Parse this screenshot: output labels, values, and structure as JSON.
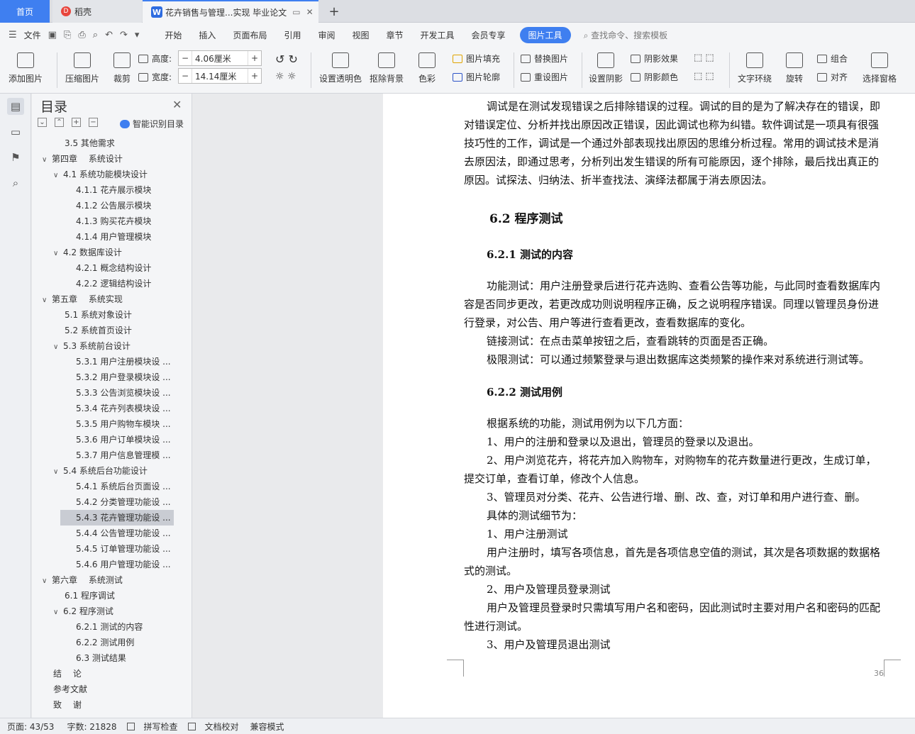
{
  "tabs": {
    "home": "首页",
    "doc1": "稻壳",
    "doc2": "花卉销售与管理...实现 毕业论文"
  },
  "menu": {
    "file": "文件",
    "items": [
      "开始",
      "插入",
      "页面布局",
      "引用",
      "审阅",
      "视图",
      "章节",
      "开发工具",
      "会员专享"
    ],
    "active": "图片工具",
    "search": "查找命令、搜索模板"
  },
  "ribbon": {
    "add_image": "添加图片",
    "compress": "压缩图片",
    "crop": "裁剪",
    "height_label": "高度:",
    "height_value": "4.06厘米",
    "width_label": "宽度:",
    "width_value": "14.14厘米",
    "transparent": "设置透明色",
    "remove_bg": "抠除背景",
    "color": "色彩",
    "fill": "图片填充",
    "outline": "图片轮廓",
    "replace": "替换图片",
    "reset": "重设图片",
    "shadow": "设置阴影",
    "shadow_effect": "阴影效果",
    "shadow_color": "阴影颜色",
    "wrap": "文字环绕",
    "rotate": "旋转",
    "group": "组合",
    "align": "对齐",
    "select_pane": "选择窗格"
  },
  "toc": {
    "title": "目录",
    "smart": "智能识别目录",
    "items": [
      {
        "label": "3.5 其他需求",
        "level": 2,
        "arrow": ""
      },
      {
        "label": "第四章　 系统设计",
        "level": 1,
        "arrow": "v"
      },
      {
        "label": "4.1 系统功能模块设计",
        "level": 2,
        "arrow": "v"
      },
      {
        "label": "4.1.1 花卉展示模块",
        "level": 3,
        "arrow": ""
      },
      {
        "label": "4.1.2 公告展示模块",
        "level": 3,
        "arrow": ""
      },
      {
        "label": "4.1.3 购买花卉模块",
        "level": 3,
        "arrow": ""
      },
      {
        "label": "4.1.4 用户管理模块",
        "level": 3,
        "arrow": ""
      },
      {
        "label": "4.2 数据库设计",
        "level": 2,
        "arrow": "v"
      },
      {
        "label": "4.2.1 概念结构设计",
        "level": 3,
        "arrow": ""
      },
      {
        "label": "4.2.2 逻辑结构设计",
        "level": 3,
        "arrow": ""
      },
      {
        "label": "第五章　 系统实现",
        "level": 1,
        "arrow": "v"
      },
      {
        "label": "5.1 系统对象设计",
        "level": 2,
        "arrow": ""
      },
      {
        "label": "5.2 系统首页设计",
        "level": 2,
        "arrow": ""
      },
      {
        "label": "5.3 系统前台设计",
        "level": 2,
        "arrow": "v"
      },
      {
        "label": "5.3.1 用户注册模块设 ...",
        "level": 3,
        "arrow": ""
      },
      {
        "label": "5.3.2 用户登录模块设 ...",
        "level": 3,
        "arrow": ""
      },
      {
        "label": "5.3.3 公告浏览模块设 ...",
        "level": 3,
        "arrow": ""
      },
      {
        "label": "5.3.4 花卉列表模块设 ...",
        "level": 3,
        "arrow": ""
      },
      {
        "label": "5.3.5 用户购物车模块 ...",
        "level": 3,
        "arrow": ""
      },
      {
        "label": "5.3.6 用户订单模块设 ...",
        "level": 3,
        "arrow": ""
      },
      {
        "label": "5.3.7 用户信息管理模 ...",
        "level": 3,
        "arrow": ""
      },
      {
        "label": "5.4 系统后台功能设计",
        "level": 2,
        "arrow": "v"
      },
      {
        "label": "5.4.1 系统后台页面设 ...",
        "level": 3,
        "arrow": ""
      },
      {
        "label": "5.4.2 分类管理功能设 ...",
        "level": 3,
        "arrow": ""
      },
      {
        "label": "5.4.3 花卉管理功能设 ...",
        "level": 3,
        "arrow": "",
        "selected": true
      },
      {
        "label": "5.4.4 公告管理功能设 ...",
        "level": 3,
        "arrow": ""
      },
      {
        "label": "5.4.5 订单管理功能设 ...",
        "level": 3,
        "arrow": ""
      },
      {
        "label": "5.4.6 用户管理功能设 ...",
        "level": 3,
        "arrow": ""
      },
      {
        "label": "第六章　 系统测试",
        "level": 1,
        "arrow": "v"
      },
      {
        "label": "6.1 程序调试",
        "level": 2,
        "arrow": ""
      },
      {
        "label": "6.2 程序测试",
        "level": 2,
        "arrow": "v"
      },
      {
        "label": "6.2.1 测试的内容",
        "level": 3,
        "arrow": ""
      },
      {
        "label": "6.2.2 测试用例",
        "level": 3,
        "arrow": ""
      },
      {
        "label": "6.3 测试结果",
        "level": 3,
        "arrow": ""
      },
      {
        "label": "结　 论",
        "level": 1,
        "arrow": ""
      },
      {
        "label": "参考文献",
        "level": 1,
        "arrow": ""
      },
      {
        "label": "致　 谢",
        "level": 1,
        "arrow": ""
      }
    ]
  },
  "doc": {
    "p1": "调试是在测试发现错误之后排除错误的过程。调试的目的是为了解决存在的错误，即对错误定位、分析并找出原因改正错误，因此调试也称为纠错。软件调试是一项具有很强技巧性的工作，调试是一个通过外部表现找出原因的思维分析过程。常用的调试技术是消去原因法，即通过思考，分析列出发生错误的所有可能原因，逐个排除，最后找出真正的原因。试探法、归纳法、折半查找法、演绎法都属于消去原因法。",
    "h62": "6.2 程序测试",
    "h621": "6.2.1 测试的内容",
    "p2": "功能测试：用户注册登录后进行花卉选购、查看公告等功能，与此同时查看数据库内容是否同步更改，若更改成功则说明程序正确，反之说明程序错误。同理以管理员身份进行登录，对公告、用户等进行查看更改，查看数据库的变化。",
    "p3": "链接测试：在点击菜单按钮之后，查看跳转的页面是否正确。",
    "p4": "极限测试：可以通过频繁登录与退出数据库这类频繁的操作来对系统进行测试等。",
    "h622": "6.2.2 测试用例",
    "p5": "根据系统的功能，测试用例为以下几方面：",
    "p6": "1、用户的注册和登录以及退出，管理员的登录以及退出。",
    "p7": "2、用户浏览花卉，将花卉加入购物车，对购物车的花卉数量进行更改，生成订单，提交订单，查看订单，修改个人信息。",
    "p8": "3、管理员对分类、花卉、公告进行增、删、改、查，对订单和用户进行查、删。",
    "p9": "具体的测试细节为：",
    "p10": "1、用户注册测试",
    "p11": "用户注册时，填写各项信息，首先是各项信息空值的测试，其次是各项数据的数据格式的测试。",
    "p12": "2、用户及管理员登录测试",
    "p13": "用户及管理员登录时只需填写用户名和密码，因此测试时主要对用户名和密码的匹配性进行测试。",
    "p14": "3、用户及管理员退出测试",
    "page_num": "36"
  },
  "status": {
    "page": "页面: 43/53",
    "words": "字数: 21828",
    "spell": "拼写检查",
    "proof": "文档校对",
    "compat": "兼容模式"
  }
}
